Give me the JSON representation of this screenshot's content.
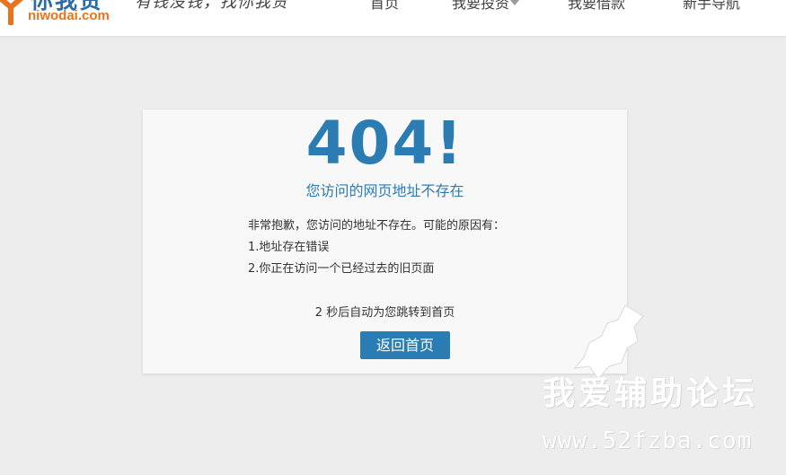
{
  "header": {
    "logo": {
      "name_cn": "你我贷",
      "name_en": "niwodai.com"
    },
    "slogan": "有钱没钱，找你我贷",
    "nav": [
      {
        "label": "首页",
        "has_dropdown": false
      },
      {
        "label": "我要投资",
        "has_dropdown": true
      },
      {
        "label": "我要借款",
        "has_dropdown": false
      },
      {
        "label": "新手导航",
        "has_dropdown": false
      }
    ]
  },
  "error_card": {
    "code": "404!",
    "subtitle": "您访问的网页地址不存在",
    "message_lines": [
      "非常抱歉，您访问的地址不存在。可能的原因有：",
      "1.地址存在错误",
      "2.你正在访问一个已经过去的旧页面"
    ],
    "countdown": "2 秒后自动为您跳转到首页",
    "home_button_label": "返回首页"
  },
  "watermark": {
    "text_cn": "我爱辅助论坛",
    "url": "www.52fzba.com"
  },
  "colors": {
    "brand_blue": "#2c7cb4",
    "brand_orange": "#e8741c",
    "page_background": "#ededed",
    "card_background": "#f8f8f8"
  }
}
